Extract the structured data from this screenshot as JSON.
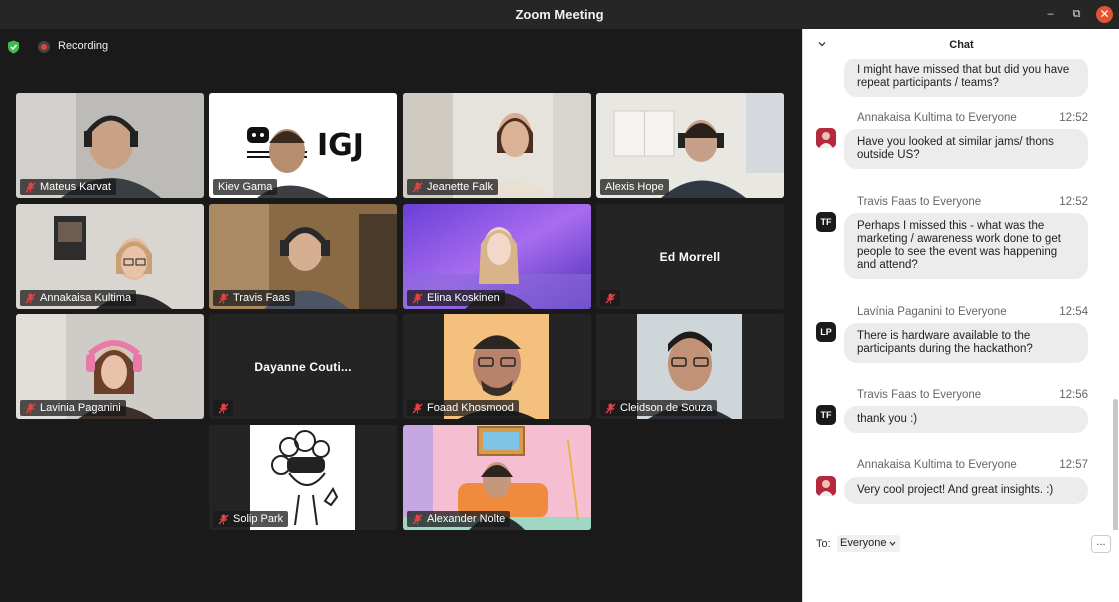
{
  "window": {
    "title": "Zoom Meeting",
    "min": "–",
    "max": "⧉",
    "close": "✕"
  },
  "status": {
    "recording": "Recording"
  },
  "participants": [
    {
      "name": "Mateus Karvat"
    },
    {
      "name": "Kiev Gama",
      "logo": "IGJ"
    },
    {
      "name": "Jeanette Falk"
    },
    {
      "name": "Alexis Hope"
    },
    {
      "name": "Annakaisa Kultima"
    },
    {
      "name": "Travis Faas"
    },
    {
      "name": "Elina Koskinen"
    },
    {
      "name": "Ed Morrell"
    },
    {
      "name": "Lavinia Paganini"
    },
    {
      "name": "Dayanne Couti..."
    },
    {
      "name": "Foaad Khosmood"
    },
    {
      "name": "Cleidson de Souza"
    },
    {
      "name": "Solip Park"
    },
    {
      "name": "Alexander Nolte"
    }
  ],
  "chat": {
    "title": "Chat",
    "messages": [
      {
        "sender": "",
        "time": "",
        "text": "I might have missed that but did you have repeat participants / teams?",
        "avatar": ""
      },
      {
        "sender": "Annakaisa Kultima to Everyone",
        "time": "12:52",
        "text": "Have you looked at similar jams/ thons outside US?",
        "avatar": ""
      },
      {
        "sender": "Travis Faas to Everyone",
        "time": "12:52",
        "text": "Perhaps I missed this - what was the marketing / awareness work done to get people to see the event was happening and attend?",
        "avatar": "TF"
      },
      {
        "sender": "Lavínia Paganini to Everyone",
        "time": "12:54",
        "text": "There is hardware available to the participants during the hackathon?",
        "avatar": "LP"
      },
      {
        "sender": "Travis Faas to Everyone",
        "time": "12:56",
        "text": "thank you :)",
        "avatar": "TF"
      },
      {
        "sender": "Annakaisa Kultima to Everyone",
        "time": "12:57",
        "text": "Very cool project! And great insights. :)",
        "avatar": ""
      }
    ],
    "to_label": "To:",
    "to_value": "Everyone",
    "more": "..."
  },
  "colors": {
    "active_speaker": "#4cd36c",
    "recording": "#e0443b",
    "close": "#e2542e"
  }
}
